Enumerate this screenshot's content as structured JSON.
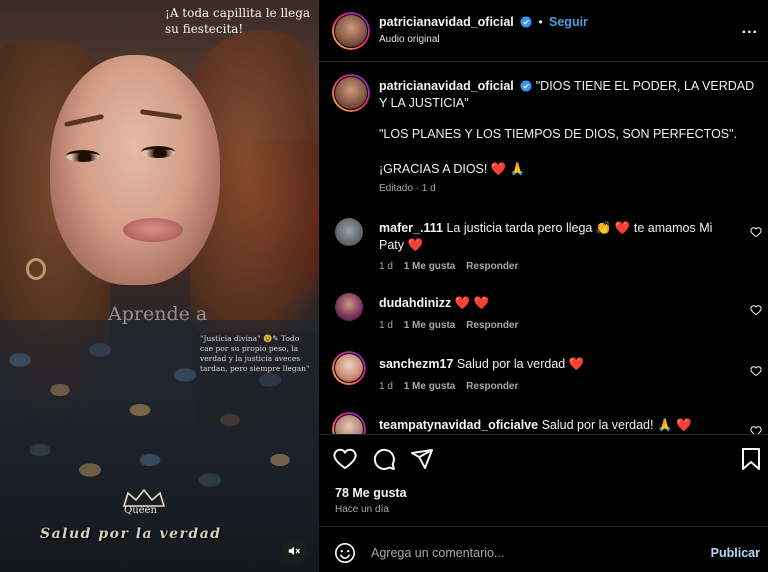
{
  "media": {
    "top_text": "¡A toda capillita le llega su fiestecita!",
    "overlay_word": "Aprende a",
    "note_text": "\"Justicia divina\" 😉✎ Todo cae por su propio peso, la verdad y la justicia aveces tardan, pero siempre llegan\"",
    "badge_text": "Queen",
    "bottom_text": "Salud por la verdad"
  },
  "header": {
    "username": "patricianavidad_oficial",
    "follow_label": "Seguir",
    "separator": "•",
    "audio_label": "Audio original",
    "more_label": "..."
  },
  "caption": {
    "username": "patricianavidad_oficial",
    "line1": "\"DIOS TIENE EL PODER, LA VERDAD Y LA JUSTICIA\"",
    "line2": "\"LOS PLANES Y LOS TIEMPOS DE DIOS, SON PERFECTOS\".",
    "line3": "¡GRACIAS A DIOS! ❤️ 🙏",
    "meta": "Editado · 1 d"
  },
  "comments": [
    {
      "username": "mafer_.111",
      "text": "La justicia tarda pero llega 👏 ❤️ te amamos Mi Paty ❤️",
      "time": "1 d",
      "likes": "1 Me gusta",
      "reply": "Responder"
    },
    {
      "username": "dudahdinizz",
      "text": "❤️ ❤️",
      "time": "1 d",
      "likes": "1 Me gusta",
      "reply": "Responder"
    },
    {
      "username": "sanchezm17",
      "text": "Salud por la verdad ❤️",
      "time": "1 d",
      "likes": "1 Me gusta",
      "reply": "Responder"
    },
    {
      "username": "teampatynavidad_oficialve",
      "text": "Salud por la verdad! 🙏 ❤️",
      "time": "",
      "likes": "",
      "reply": ""
    }
  ],
  "actions": {
    "likes": "78 Me gusta",
    "time_ago": "Hace un día"
  },
  "composer": {
    "placeholder": "Agrega un comentario...",
    "post_label": "Publicar"
  },
  "colors": {
    "accent": "#4a9fe8",
    "heart": "#ff3040",
    "background": "#000000",
    "divider": "#262626"
  }
}
